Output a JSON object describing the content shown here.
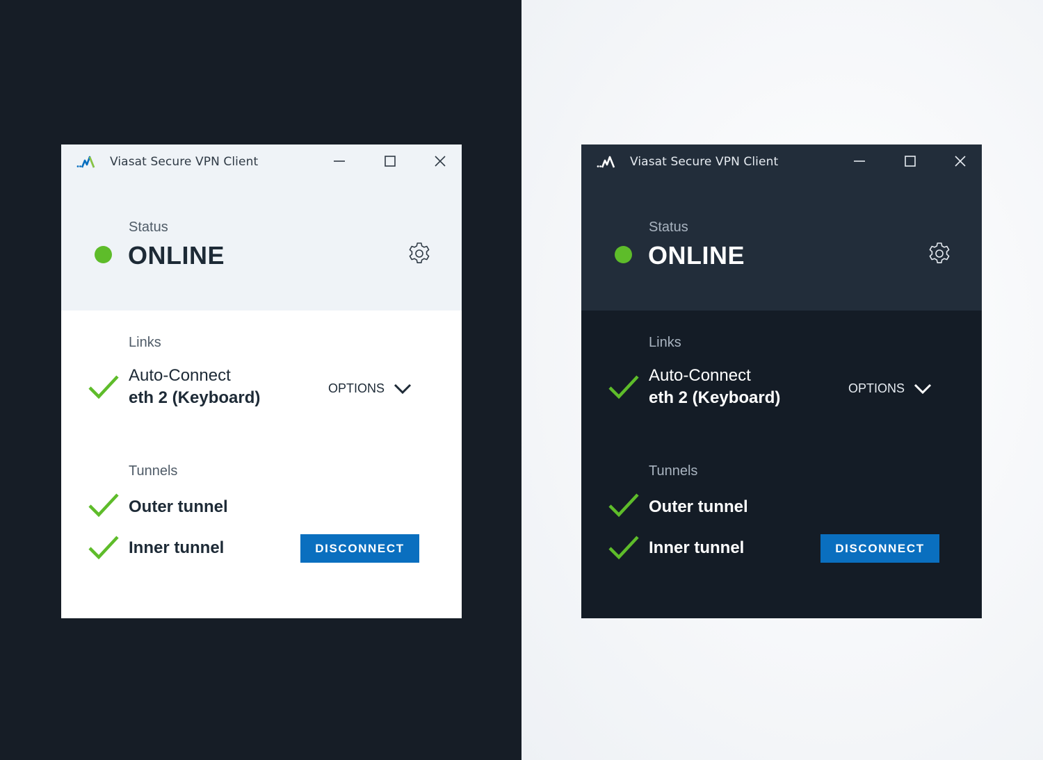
{
  "app_title": "Viasat Secure VPN Client",
  "window_controls": {
    "minimize": "minimize-icon",
    "maximize": "maximize-icon",
    "close": "close-icon"
  },
  "status": {
    "label": "Status",
    "value": "ONLINE",
    "indicator_color": "#5ebc2a"
  },
  "settings_icon": "gear-icon",
  "links": {
    "label": "Links",
    "name": "Auto-Connect",
    "interface": "eth 2 (Keyboard)",
    "options_label": "OPTIONS"
  },
  "tunnels": {
    "label": "Tunnels",
    "items": [
      "Outer tunnel",
      "Inner tunnel"
    ]
  },
  "disconnect_label": "DISCONNECT",
  "colors": {
    "accent_green": "#5ebc2a",
    "button_blue": "#0a6fbf",
    "dark_bg": "#141c26",
    "light_header_bg": "#eff3f7"
  }
}
